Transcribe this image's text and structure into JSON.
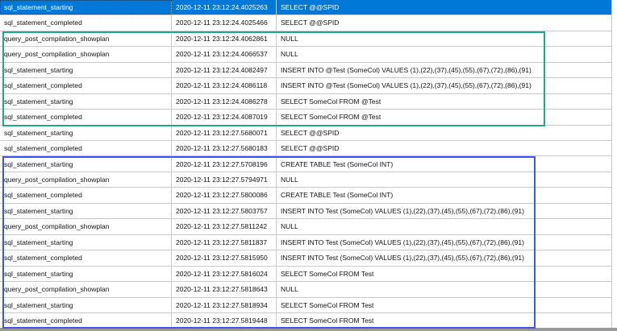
{
  "selected_row": 0,
  "highlight_colors": {
    "green_box": "#22a98a",
    "blue_box": "#3e55e6",
    "selection": "#0078d7"
  },
  "rows": [
    [
      "sql_statement_starting",
      "2020-12-11 23:12:24.4025263",
      "SELECT @@SPID"
    ],
    [
      "sql_statement_completed",
      "2020-12-11 23:12:24.4025466",
      "SELECT @@SPID"
    ],
    [
      "query_post_compilation_showplan",
      "2020-12-11 23:12:24.4062861",
      "NULL"
    ],
    [
      "query_post_compilation_showplan",
      "2020-12-11 23:12:24.4066537",
      "NULL"
    ],
    [
      "sql_statement_starting",
      "2020-12-11 23:12:24.4082497",
      "INSERT INTO @Test (SomeCol)  VALUES (1),(22),(37),(45),(55),(67),(72),(86),(91)"
    ],
    [
      "sql_statement_completed",
      "2020-12-11 23:12:24.4086118",
      "INSERT INTO @Test (SomeCol)  VALUES (1),(22),(37),(45),(55),(67),(72),(86),(91)"
    ],
    [
      "sql_statement_starting",
      "2020-12-11 23:12:24.4086278",
      "SELECT SomeCol FROM @Test"
    ],
    [
      "sql_statement_completed",
      "2020-12-11 23:12:24.4087019",
      "SELECT SomeCol FROM @Test"
    ],
    [
      "sql_statement_starting",
      "2020-12-11 23:12:27.5680071",
      "SELECT @@SPID"
    ],
    [
      "sql_statement_completed",
      "2020-12-11 23:12:27.5680183",
      "SELECT @@SPID"
    ],
    [
      "sql_statement_starting",
      "2020-12-11 23:12:27.5708196",
      "CREATE TABLE Test (SomeCol INT)"
    ],
    [
      "query_post_compilation_showplan",
      "2020-12-11 23:12:27.5794971",
      "NULL"
    ],
    [
      "sql_statement_completed",
      "2020-12-11 23:12:27.5800086",
      "CREATE TABLE Test (SomeCol INT)"
    ],
    [
      "sql_statement_starting",
      "2020-12-11 23:12:27.5803757",
      "INSERT INTO Test (SomeCol)  VALUES (1),(22),(37),(45),(55),(67),(72),(86),(91)"
    ],
    [
      "query_post_compilation_showplan",
      "2020-12-11 23:12:27.5811242",
      "NULL"
    ],
    [
      "sql_statement_starting",
      "2020-12-11 23:12:27.5811837",
      "INSERT INTO Test (SomeCol)  VALUES (1),(22),(37),(45),(55),(67),(72),(86),(91)"
    ],
    [
      "sql_statement_completed",
      "2020-12-11 23:12:27.5815950",
      "INSERT INTO Test (SomeCol)  VALUES (1),(22),(37),(45),(55),(67),(72),(86),(91)"
    ],
    [
      "sql_statement_starting",
      "2020-12-11 23:12:27.5816024",
      "SELECT SomeCol FROM Test"
    ],
    [
      "query_post_compilation_showplan",
      "2020-12-11 23:12:27.5818643",
      "NULL"
    ],
    [
      "sql_statement_starting",
      "2020-12-11 23:12:27.5818934",
      "SELECT SomeCol FROM Test"
    ],
    [
      "sql_statement_completed",
      "2020-12-11 23:12:27.5819448",
      "SELECT SomeCol FROM Test"
    ]
  ]
}
